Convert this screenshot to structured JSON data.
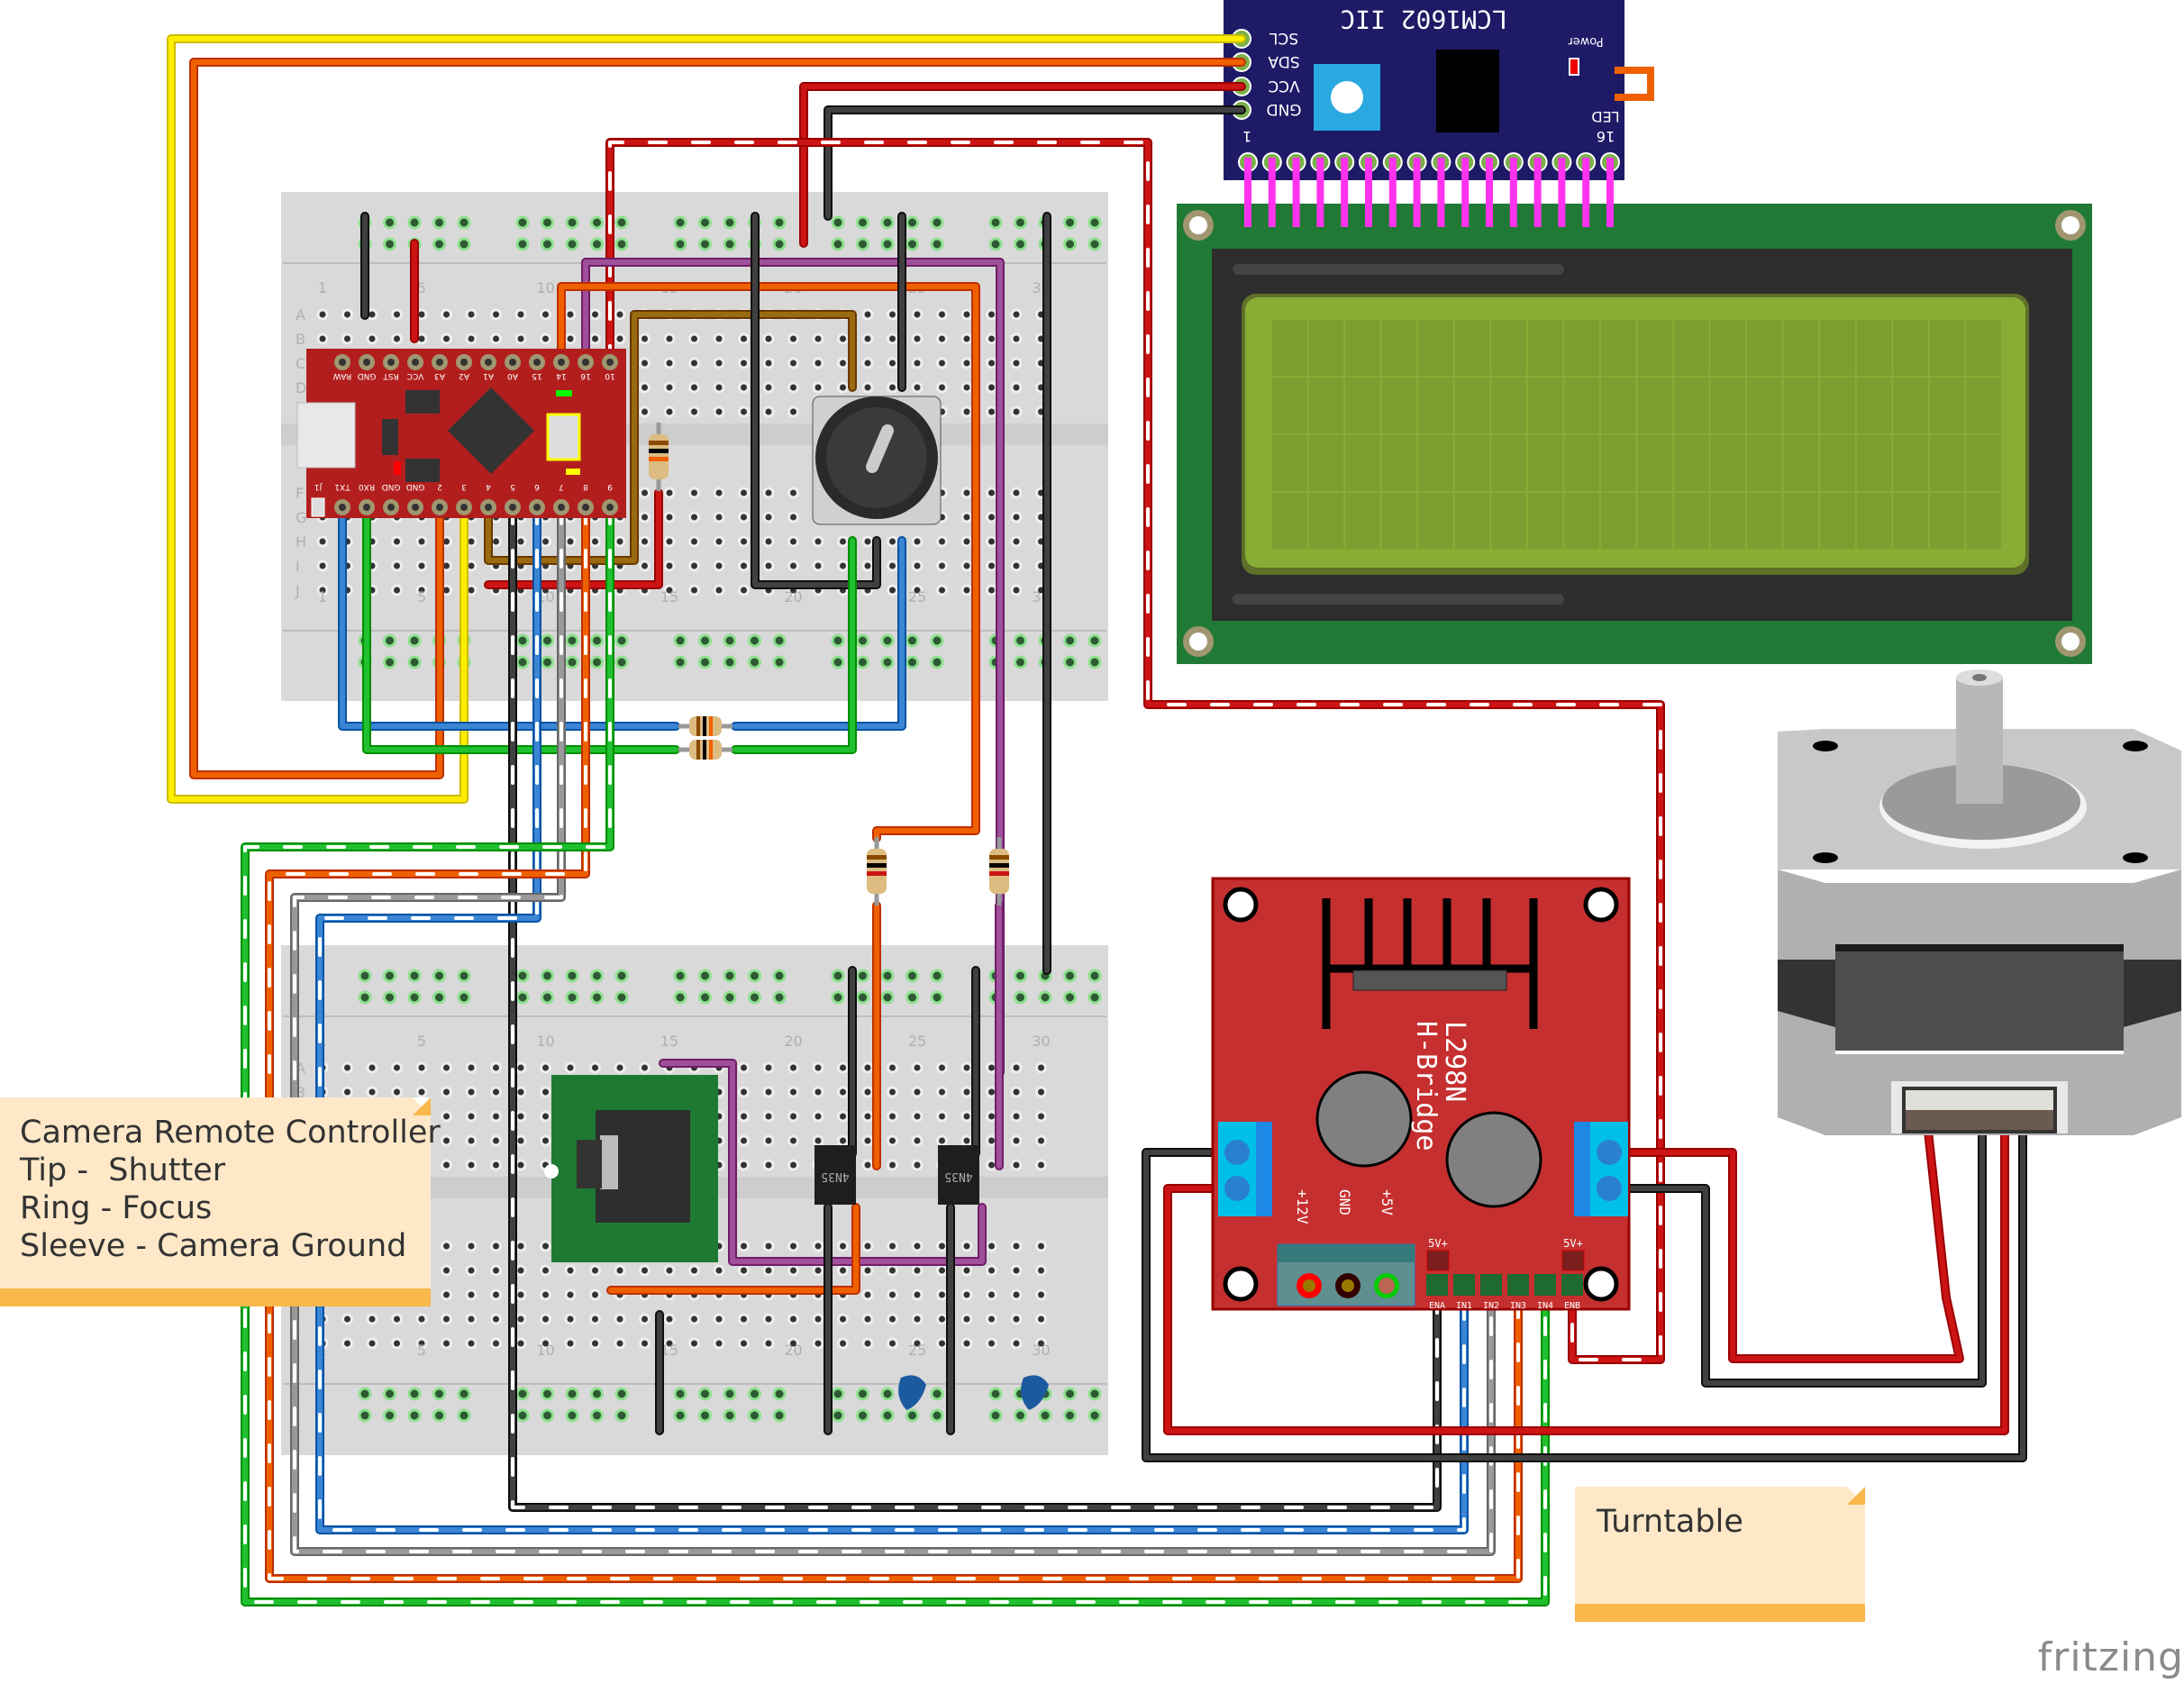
{
  "diagram": {
    "tool": "fritzing",
    "logo_text": "fritzing",
    "colors": {
      "wire_yellow": "#ffee00",
      "wire_orange": "#ef6100",
      "wire_red": "#cc1414",
      "wire_black": "#404040",
      "wire_blue": "#3a85d4",
      "wire_green": "#20c030",
      "wire_purple": "#a0509a",
      "wire_brown": "#9a6a10",
      "wire_gray": "#999999",
      "breadboard": "#d9d9d9",
      "arduino_pcb": "#b21e1e",
      "l298n_pcb": "#c62f2f",
      "lcd_pcb": "#207a35",
      "lcd_screen": "#7ea032",
      "i2c_pcb": "#1e1a66",
      "note_bg": "#fee8c8",
      "note_bar": "#f9b84b"
    }
  },
  "notes": [
    {
      "id": "camera-note",
      "lines": [
        "Camera Remote Controller",
        "Tip -  Shutter",
        "Ring - Focus",
        "Sleeve - Camera Ground"
      ]
    },
    {
      "id": "turntable-note",
      "lines": [
        "Turntable"
      ]
    }
  ],
  "i2c_module": {
    "title": "LCM1602 IIC",
    "power_label": "Power",
    "pins": [
      "SCL",
      "SDA",
      "VCC",
      "GND"
    ],
    "led_label": "LED",
    "pin1_label": "1",
    "pin16_label": "16"
  },
  "lcd": {
    "columns": 20,
    "rows": 4
  },
  "arduino": {
    "top_pins": [
      "RAW",
      "GND",
      "RST",
      "VCC",
      "A3",
      "A2",
      "A1",
      "A0",
      "15",
      "14",
      "16",
      "10"
    ],
    "bottom_pins": [
      "J1",
      "TX1",
      "RX0",
      "GND",
      "GND",
      "2",
      "3",
      "4",
      "5",
      "6",
      "7",
      "8",
      "9"
    ]
  },
  "breadboard": {
    "row_letters": [
      "A",
      "B",
      "C",
      "D",
      "E",
      "F",
      "G",
      "H",
      "I",
      "J"
    ],
    "column_numbers": [
      "1",
      "5",
      "10",
      "15",
      "20",
      "25",
      "30"
    ]
  },
  "optocouplers": [
    {
      "label": "4N35"
    },
    {
      "label": "4N35"
    }
  ],
  "l298n": {
    "title": "L298N",
    "subtitle": "H-Bridge",
    "power_labels": [
      "+12V",
      "GND",
      "+5V"
    ],
    "jumper_labels": [
      "5V+",
      "5V+"
    ],
    "control_pins": [
      "ENA",
      "IN1",
      "IN2",
      "IN3",
      "IN4",
      "ENB"
    ]
  },
  "components": [
    "Arduino Pro Micro",
    "LCM1602 IIC adapter",
    "20x4 LCD",
    "Rotary encoder",
    "3.5mm audio jack",
    "4N35 optocoupler x2",
    "Ceramic capacitor x2",
    "Resistor x5",
    "L298N H-Bridge",
    "Stepper motor"
  ]
}
